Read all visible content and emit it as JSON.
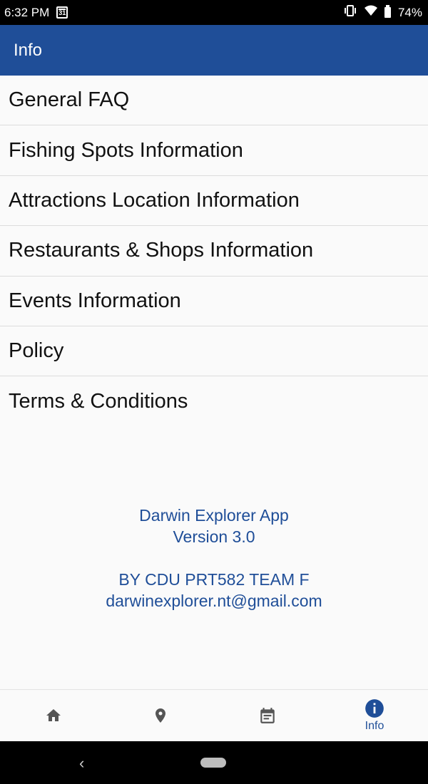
{
  "status_bar": {
    "time": "6:32 PM",
    "calendar_day": "31",
    "battery": "74%"
  },
  "app_bar": {
    "title": "Info"
  },
  "menu": [
    {
      "label": "General FAQ"
    },
    {
      "label": "Fishing Spots Information"
    },
    {
      "label": "Attractions Location Information"
    },
    {
      "label": "Restaurants & Shops Information"
    },
    {
      "label": "Events Information"
    },
    {
      "label": "Policy"
    },
    {
      "label": "Terms & Conditions"
    }
  ],
  "about": {
    "app_name": "Darwin Explorer App",
    "version": "Version 3.0",
    "team": "BY CDU PRT582 TEAM F",
    "email": "darwinexplorer.nt@gmail.com"
  },
  "bottom_nav": {
    "items": [
      {
        "icon": "home-icon",
        "label": ""
      },
      {
        "icon": "map-pin-icon",
        "label": ""
      },
      {
        "icon": "calendar-icon",
        "label": ""
      },
      {
        "icon": "info-icon",
        "label": "Info"
      }
    ],
    "active_index": 3
  },
  "colors": {
    "primary": "#1f4e98",
    "background": "#fafafa",
    "divider": "#dcdcdc"
  }
}
